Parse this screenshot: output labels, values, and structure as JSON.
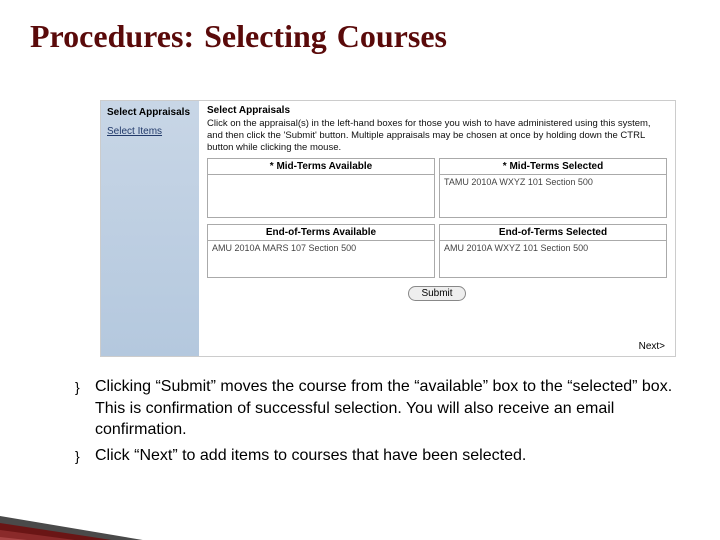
{
  "heading": {
    "w1": "Procedures:",
    "w2": "Selecting",
    "w3": "Courses"
  },
  "sidebar": {
    "link1": "Select Appraisals",
    "link2": "Select Items"
  },
  "panel": {
    "heading": "Select Appraisals",
    "instructions": "Click on the appraisal(s) in the left-hand boxes for those you wish to have administered using this system, and then click the 'Submit' button.  Multiple appraisals may be chosen at once by holding down the CTRL button while clicking the mouse.",
    "boxes": {
      "midAvailHead": "* Mid-Terms Available",
      "midSelHead": "* Mid-Terms Selected",
      "midSelItem": "TAMU 2010A WXYZ 101 Section 500",
      "eotAvailHead": "End-of-Terms Available",
      "eotAvailItem": "AMU 2010A MARS 107 Section 500",
      "eotSelHead": "End-of-Terms Selected",
      "eotSelItem": "AMU 2010A WXYZ 101 Section 500"
    },
    "submit": "Submit",
    "next": "Next>"
  },
  "bullets": {
    "mark": "}",
    "b1": "Clicking “Submit” moves the course from the “available” box to the “selected” box.  This is confirmation of successful selection.  You will also receive an email confirmation.",
    "b2": "Click “Next” to add items to courses that have been selected."
  }
}
